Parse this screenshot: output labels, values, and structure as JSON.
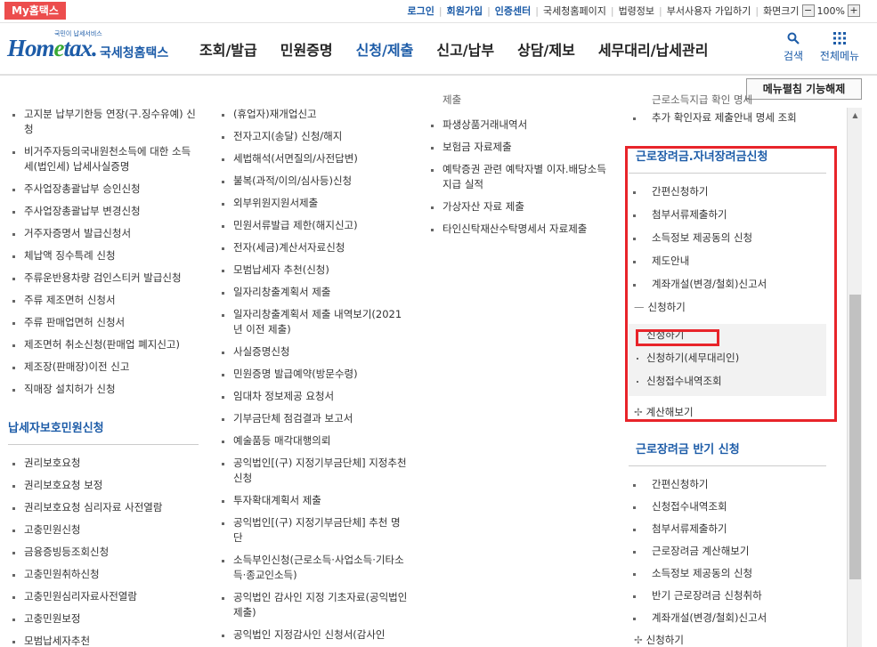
{
  "topbar": {
    "brand": "My홈택스",
    "links": [
      "로그인",
      "회원가입",
      "인증센터",
      "국세청홈페이지",
      "법령정보",
      "부서사용자 가입하기",
      "화면크기"
    ],
    "zoom": "100%",
    "zoom_minus": "−",
    "zoom_plus": "+"
  },
  "header": {
    "logo_sub": "국민이 납세서비스",
    "logo_mark_a": "Hom",
    "logo_mark_e": "e",
    "logo_mark_b": "tax.",
    "logo_tail": "국세청홈택스",
    "gnb": [
      "조회/발급",
      "민원증명",
      "신청/제출",
      "신고/납부",
      "상담/제보",
      "세무대리/납세관리"
    ],
    "active_gnb": "신청/제출",
    "search_label": "검색",
    "menu_label": "전체메뉴",
    "fold_button": "메뉴펼침 기능해제"
  },
  "col1": {
    "items": [
      "고지분 납부기한등 연장(구.징수유예) 신청",
      "비거주자등의국내원천소득에 대한 소득세(법인세) 납세사실증명",
      "주사업장총괄납부 승인신청",
      "주사업장총괄납부 변경신청",
      "거주자증명서 발급신청서",
      "체납액 징수특례 신청",
      "주류운반용차량 검인스티커 발급신청",
      "주류 제조면허 신청서",
      "주류 판매업면허 신청서",
      "제조면허 취소신청(판매업 폐지신고)",
      "제조장(판매장)이전 신고",
      "직매장 설치허가 신청"
    ],
    "section_title": "납세자보호민원신청",
    "section_items": [
      "권리보호요청",
      "권리보호요청 보정",
      "권리보호요청 심리자료 사전열람",
      "고충민원신청",
      "금융증빙등조회신청",
      "고충민원취하신청",
      "고충민원심리자료사전열람",
      "고충민원보정",
      "모범납세자추천"
    ]
  },
  "col2": {
    "items": [
      "(휴업자)재개업신고",
      "전자고지(송달) 신청/해지",
      "세법해석(서면질의/사전답변)",
      "불복(과적/이의/심사등)신청",
      "외부위원지원서제출",
      "민원서류발급 제한(해지신고)",
      "전자(세금)계산서자료신청",
      "모범납세자 추천(신청)",
      "일자리창출계획서 제출",
      "일자리창출계획서 제출 내역보기(2021년 이전 제출)",
      "사실증명신청",
      "민원증명 발급예약(방문수령)",
      "임대차 정보제공 요청서",
      "기부금단체 점검결과 보고서",
      "예술품등 매각대행의뢰",
      "공익법인[(구) 지정기부금단체] 지정추천 신청",
      "투자확대계획서 제출",
      "공익법인[(구) 지정기부금단체] 추천 명단",
      "소득부인신청(근로소득·사업소득·기타소득·종교인소득)",
      "공익법인 감사인 지정 기초자료(공익법인 제출)",
      "공익법인 지정감사인 신청서(감사인"
    ]
  },
  "col3": {
    "top_cut": "제출",
    "items": [
      "파생상품거래내역서",
      "보험금 자료제출",
      "예탁증권 관련 예탁자별 이자.배당소득 지급 실적",
      "가상자산 자료 제출",
      "타인신탁재산수탁명세서 자료제출"
    ]
  },
  "col4": {
    "top_cut": "근로소득지급 확인 명세",
    "top_item": "추가 확인자료 제출안내 명세 조회",
    "box_title": "근로장려금.자녀장려금신청",
    "box_items": [
      "간편신청하기",
      "첨부서류제출하기",
      "소득정보 제공동의 신청",
      "제도안내",
      "계좌개설(변경/철회)신고서"
    ],
    "expand_label": "신청하기",
    "sub_items": [
      "신청하기",
      "신청하기(세무대리인)",
      "신청접수내역조회"
    ],
    "calc_label": "계산해보기",
    "section_title": "근로장려금 반기 신청",
    "section_items": [
      "간편신청하기",
      "신청접수내역조회",
      "첨부서류제출하기",
      "근로장려금 계산해보기",
      "소득정보 제공동의 신청",
      "반기 근로장려금 신청취하",
      "계좌개설(변경/철회)신고서"
    ],
    "section_expand": "신청하기"
  }
}
